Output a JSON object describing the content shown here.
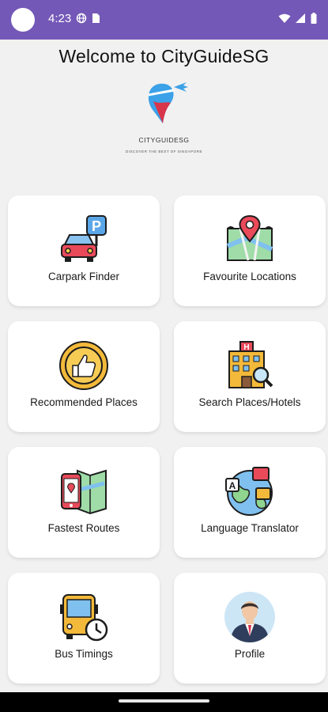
{
  "status_bar": {
    "time": "4:23",
    "color": "#7458b7"
  },
  "header": {
    "title": "Welcome to CityGuideSG",
    "brand_name": "CITYGUIDESG",
    "tagline": "DISCOVER THE BEST OF SINGAPORE"
  },
  "menu": {
    "carpark_finder": "Carpark Finder",
    "favourite_locations": "Favourite Locations",
    "recommended_places": "Recommended Places",
    "search_places_hotels": "Search Places/Hotels",
    "fastest_routes": "Fastest Routes",
    "language_translator": "Language Translator",
    "bus_timings": "Bus Timings",
    "profile": "Profile"
  },
  "icons": {
    "carpark_finder": "car-parking-icon",
    "favourite_locations": "map-pin-icon",
    "recommended_places": "thumbs-up-badge-icon",
    "search_places_hotels": "hotel-search-icon",
    "fastest_routes": "phone-map-icon",
    "language_translator": "globe-translate-icon",
    "bus_timings": "bus-clock-icon",
    "profile": "user-avatar-icon"
  }
}
